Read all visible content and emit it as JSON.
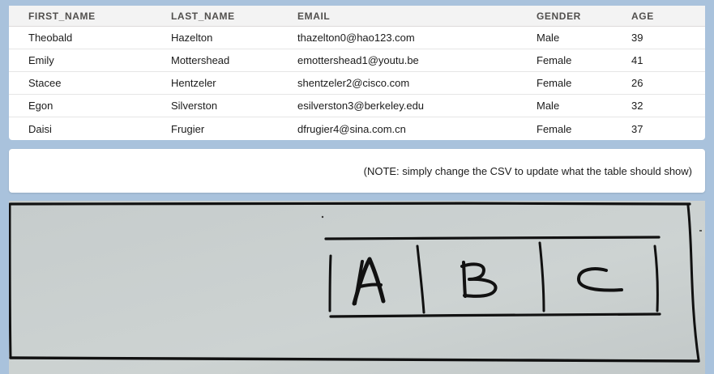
{
  "table": {
    "columns": [
      "FIRST_NAME",
      "LAST_NAME",
      "EMAIL",
      "GENDER",
      "AGE"
    ],
    "rows": [
      [
        "Theobald",
        "Hazelton",
        "thazelton0@hao123.com",
        "Male",
        "39"
      ],
      [
        "Emily",
        "Mottershead",
        "emottershead1@youtu.be",
        "Female",
        "41"
      ],
      [
        "Stacee",
        "Hentzeler",
        "shentzeler2@cisco.com",
        "Female",
        "26"
      ],
      [
        "Egon",
        "Silverston",
        "esilverston3@berkeley.edu",
        "Male",
        "32"
      ],
      [
        "Daisi",
        "Frugier",
        "dfrugier4@sina.com.cn",
        "Female",
        "37"
      ]
    ]
  },
  "note": {
    "text": "(NOTE: simply change the CSV to update what the table should show)"
  },
  "sketch": {
    "cells": [
      "A",
      "B",
      "C"
    ]
  },
  "colors": {
    "page_background": "#a9c2dc",
    "header_background": "#f3f3f3",
    "sketch_background": "#c9cfcf",
    "ink": "#111111"
  }
}
